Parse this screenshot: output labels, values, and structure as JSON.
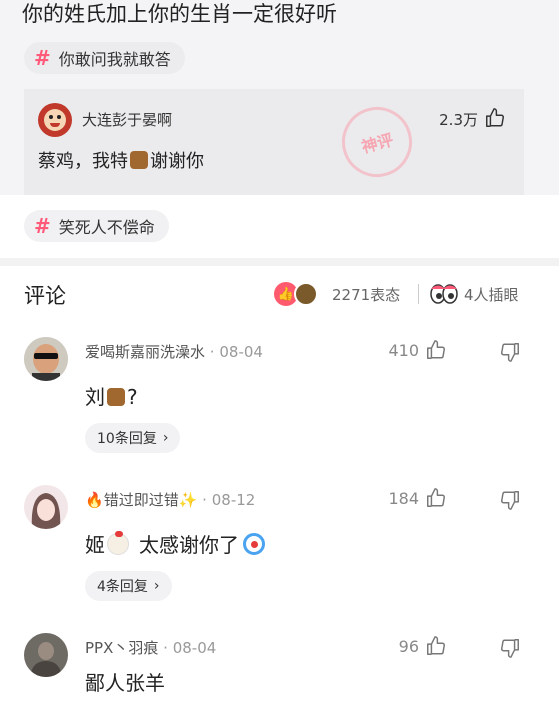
{
  "post": {
    "title": "你的姓氏加上你的生肖一定很好听",
    "topics": [
      {
        "label": "你敢问我就敢答"
      },
      {
        "label": "笑死人不偿命"
      }
    ]
  },
  "god_comment": {
    "user": "大连彭于晏啊",
    "likes": "2.3万",
    "text_before": "蔡鸡，我特",
    "text_after": "谢谢你",
    "stamp": "神评"
  },
  "comments_header": {
    "title": "评论",
    "reactions_count": "2271表态",
    "peek_count": "4人插眼"
  },
  "comments": [
    {
      "user": "爱喝斯嘉丽洗澡水",
      "date": "08-04",
      "likes": "410",
      "text_before": "刘",
      "text_after": "?",
      "replies": "10条回复"
    },
    {
      "user": "错过即过错",
      "date": "08-12",
      "likes": "184",
      "text_before": "姬",
      "text_after": "太感谢你了",
      "replies": "4条回复"
    },
    {
      "user": "PPX丶羽痕",
      "date": "08-04",
      "likes": "96",
      "text": "鄙人张羊"
    }
  ],
  "icons": {
    "hash": "#",
    "chevron": "›",
    "dot": "·",
    "fire": "🔥",
    "sparkle": "✨"
  },
  "colors": {
    "accent": "#ff5a7a",
    "card_bg": "#f4f4f6"
  }
}
